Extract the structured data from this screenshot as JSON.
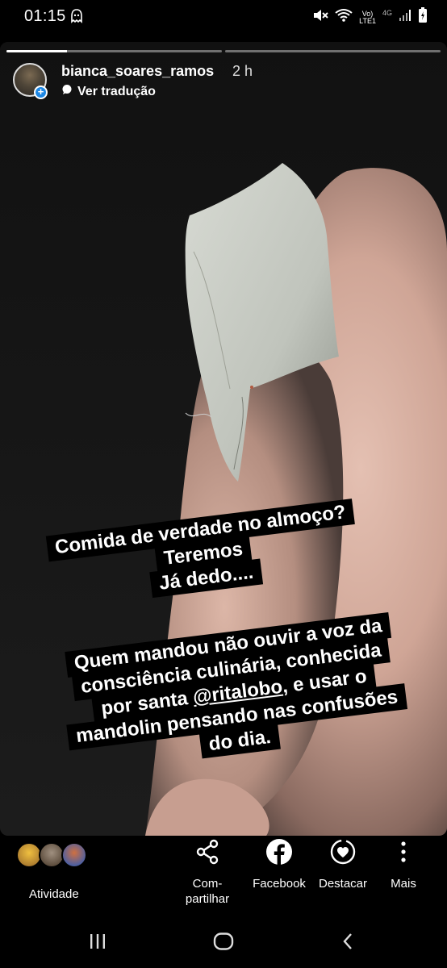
{
  "status_bar": {
    "time": "01:15",
    "volte_top": "Vo)",
    "volte_bottom": "LTE1",
    "network": "4G"
  },
  "story": {
    "progress": 0.28,
    "username": "bianca_soares_ramos",
    "time_ago": "2 h",
    "translate_label": "Ver tradução",
    "caption1": {
      "lines": [
        "Comida de verdade no almoço?",
        "Teremos",
        "Já dedo...."
      ]
    },
    "caption2": {
      "line1": "Quem mandou não ouvir a voz da",
      "line2": "consciência culinária, conhecida",
      "line3_before": "por santa ",
      "line3_mention": "@ritalobo",
      "line3_after": ", e usar o",
      "line4": "mandolin pensando nas confusões",
      "line5": "do dia."
    }
  },
  "actions": {
    "activity_label": "Atividade",
    "share_label_1": "Com-",
    "share_label_2": "partilhar",
    "facebook_label": "Facebook",
    "highlight_label": "Destacar",
    "more_label": "Mais"
  },
  "icons": {
    "status_notification": "ghost-icon",
    "mute": "mute-icon",
    "wifi": "wifi-icon",
    "signal": "signal-icon",
    "battery": "battery-icon",
    "translate": "speech-bubble-icon",
    "share": "share-icon",
    "facebook": "facebook-icon",
    "highlight": "highlight-heart-icon",
    "more": "vertical-dots-icon",
    "nav_recents": "recents-icon",
    "nav_home": "home-icon",
    "nav_back": "back-icon"
  },
  "colors": {
    "badge_blue": "#1e88e5",
    "background": "#000000"
  }
}
